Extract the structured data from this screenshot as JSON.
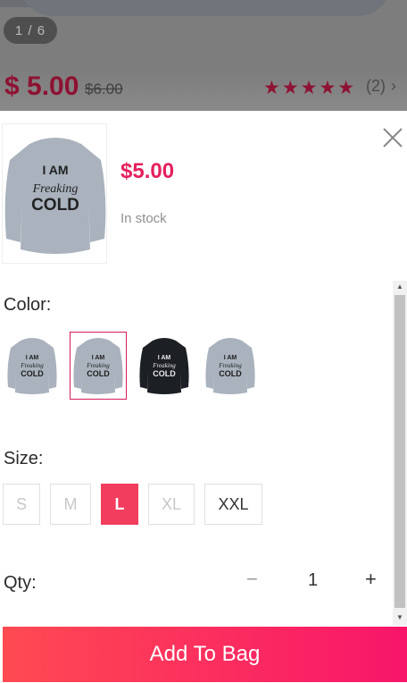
{
  "background": {
    "image_counter": "1 / 6",
    "price": "$ 5.00",
    "old_price": "$6.00",
    "stars": "★★★★★",
    "review_count": "(2)"
  },
  "product": {
    "price": "$5.00",
    "stock": "In stock",
    "shirt_text": [
      "I AM",
      "Freaking",
      "COLD"
    ]
  },
  "color": {
    "label": "Color:",
    "options": [
      "gray",
      "gray",
      "black",
      "gray"
    ],
    "selected_index": 1
  },
  "size": {
    "label": "Size:",
    "options": [
      "S",
      "M",
      "L",
      "XL",
      "XXL"
    ],
    "selected": "L"
  },
  "qty": {
    "label": "Qty:",
    "minus": "−",
    "value": "1",
    "plus": "+"
  },
  "cta": {
    "label": "Add To Bag"
  },
  "colors": {
    "accent": "#e5205c",
    "button_start": "#ff4a52",
    "button_end": "#f8156a"
  }
}
